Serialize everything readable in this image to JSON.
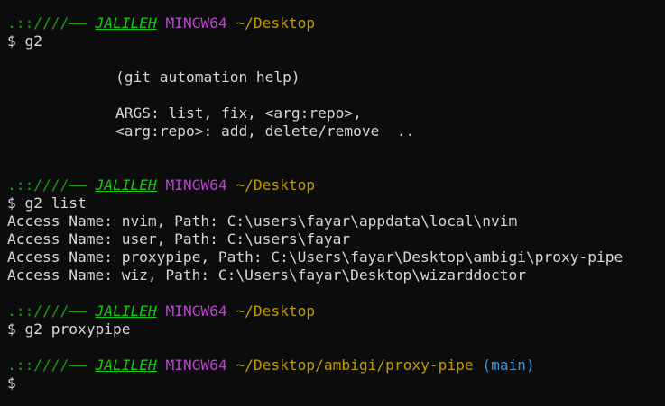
{
  "terminal": {
    "prompts": [
      {
        "decoration": ".::∕∕∕∕――",
        "user": "JALILEH",
        "host": "MINGW64",
        "cwd": "~/Desktop",
        "branch": "",
        "command": "$ g2"
      },
      {
        "decoration": ".::∕∕∕∕――",
        "user": "JALILEH",
        "host": "MINGW64",
        "cwd": "~/Desktop",
        "branch": "",
        "command": "$ g2 list"
      },
      {
        "decoration": ".::∕∕∕∕――",
        "user": "JALILEH",
        "host": "MINGW64",
        "cwd": "~/Desktop",
        "branch": "",
        "command": "$ g2 proxypipe"
      },
      {
        "decoration": ".::∕∕∕∕――",
        "user": "JALILEH",
        "host": "MINGW64",
        "cwd": "~/Desktop/ambigi/proxy-pipe",
        "branch": "(main)",
        "command": "$"
      }
    ],
    "help_output": [
      "(git automation help)",
      "ARGS: list, fix, <arg:repo>,",
      "<arg:repo>: add, delete/remove  .."
    ],
    "list_output": [
      "Access Name: nvim, Path: C:\\users\\fayar\\appdata\\local\\nvim",
      "Access Name: user, Path: C:\\users\\fayar",
      "Access Name: proxypipe, Path: C:\\Users\\fayar\\Desktop\\ambigi\\proxy-pipe",
      "Access Name: wiz, Path: C:\\Users\\fayar\\Desktop\\wizarddoctor"
    ]
  },
  "colors": {
    "background": "#0c0c0c",
    "text": "#d7d7d7",
    "decoration": "#13a10e",
    "user": "#16c60c",
    "host": "#b148c6",
    "path": "#c19c00",
    "branch": "#3a96dd"
  }
}
